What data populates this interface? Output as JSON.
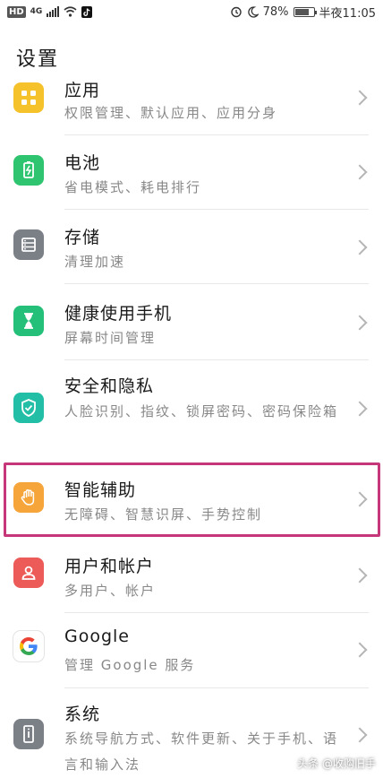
{
  "status_bar": {
    "hd": "HD",
    "network": "4G",
    "battery_text": "78%",
    "battery_level": 0.78,
    "time": "半夜11:05"
  },
  "header": {
    "title": "设置"
  },
  "items": [
    {
      "title": "应用",
      "subtitle": "权限管理、默认应用、应用分身",
      "icon": "apps-grid-icon",
      "color": "#f6c22c"
    },
    {
      "title": "电池",
      "subtitle": "省电模式、耗电排行",
      "icon": "battery-icon",
      "color": "#2fc46f"
    },
    {
      "title": "存储",
      "subtitle": "清理加速",
      "icon": "storage-icon",
      "color": "#7b7f86"
    },
    {
      "title": "健康使用手机",
      "subtitle": "屏幕时间管理",
      "icon": "hourglass-icon",
      "color": "#24c079"
    },
    {
      "title": "安全和隐私",
      "subtitle": "人脸识别、指纹、锁屏密码、密码保险箱",
      "icon": "shield-icon",
      "color": "#22bfa6"
    },
    {
      "title": "智能辅助",
      "subtitle": "无障碍、智慧识屏、手势控制",
      "icon": "hand-icon",
      "color": "#f5a53a"
    },
    {
      "title": "用户和帐户",
      "subtitle": "多用户、帐户",
      "icon": "user-icon",
      "color": "#ec5b57"
    },
    {
      "title": "Google",
      "subtitle": "管理 Google 服务",
      "icon": "google-icon",
      "color": "#ffffff"
    },
    {
      "title": "系统",
      "subtitle": "系统导航方式、软件更新、关于手机、语言和输入法",
      "icon": "system-icon",
      "color": "#7b7f86"
    }
  ],
  "watermark": "头条 @收购旧手"
}
